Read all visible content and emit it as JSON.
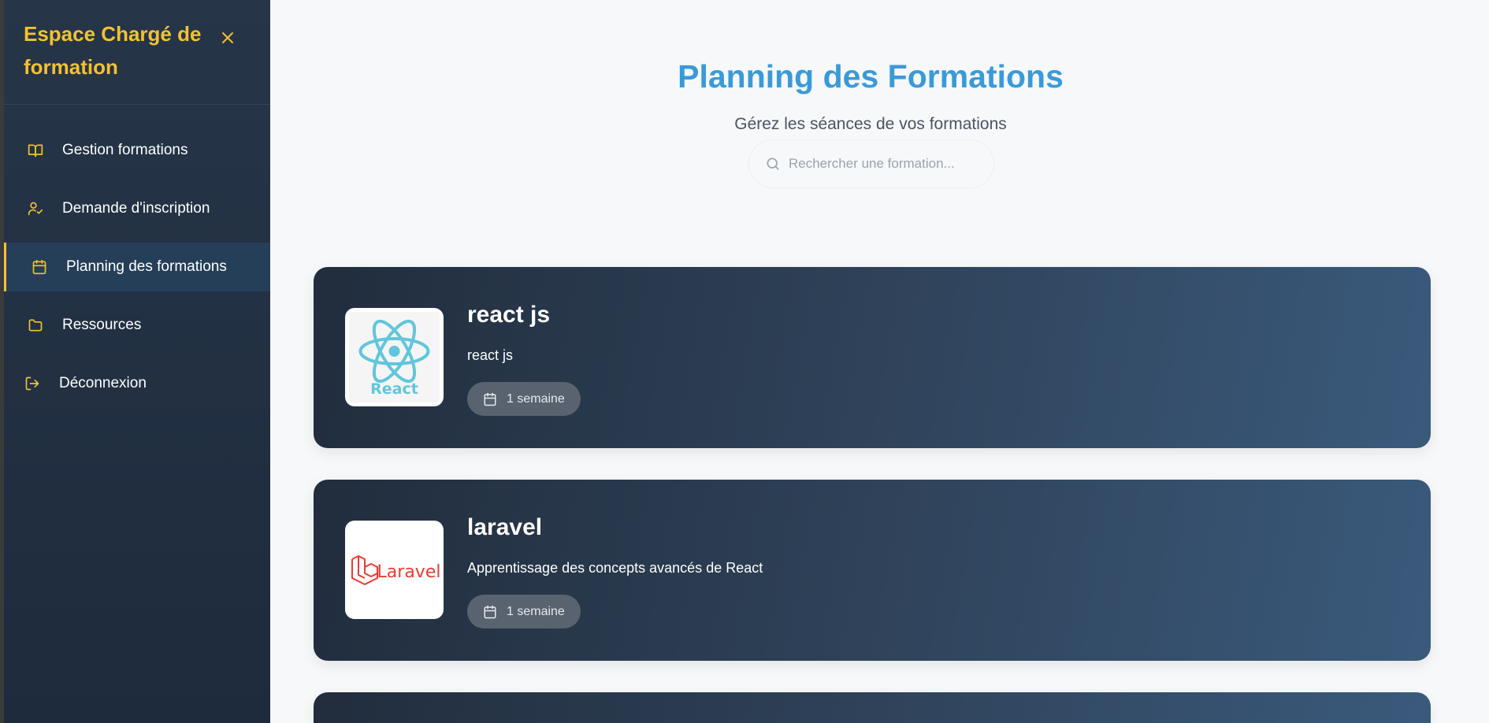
{
  "sidebar": {
    "brand": "Espace Chargé de formation",
    "items": [
      {
        "label": "Gestion formations",
        "icon": "book-icon"
      },
      {
        "label": "Demande d'inscription",
        "icon": "user-check-icon"
      },
      {
        "label": "Planning des formations",
        "icon": "calendar-icon",
        "active": true
      },
      {
        "label": "Ressources",
        "icon": "folder-icon"
      },
      {
        "label": "Déconnexion",
        "icon": "logout-icon"
      }
    ]
  },
  "main": {
    "title": "Planning des Formations",
    "subtitle": "Gérez les séances de vos formations",
    "search": {
      "placeholder": "Rechercher une formation..."
    },
    "formations": [
      {
        "title": "react js",
        "description": "react js",
        "duration": "1 semaine",
        "logo_text": "React",
        "logo_color": "#61c6dc"
      },
      {
        "title": "laravel",
        "description": "Apprentissage des concepts avancés de React",
        "duration": "1 semaine",
        "logo_text": "Laravel",
        "logo_color": "#ee3a30"
      }
    ]
  },
  "colors": {
    "accent": "#f2c230",
    "title_blue": "#3a9ad9",
    "sidebar_bg": "#263548"
  }
}
